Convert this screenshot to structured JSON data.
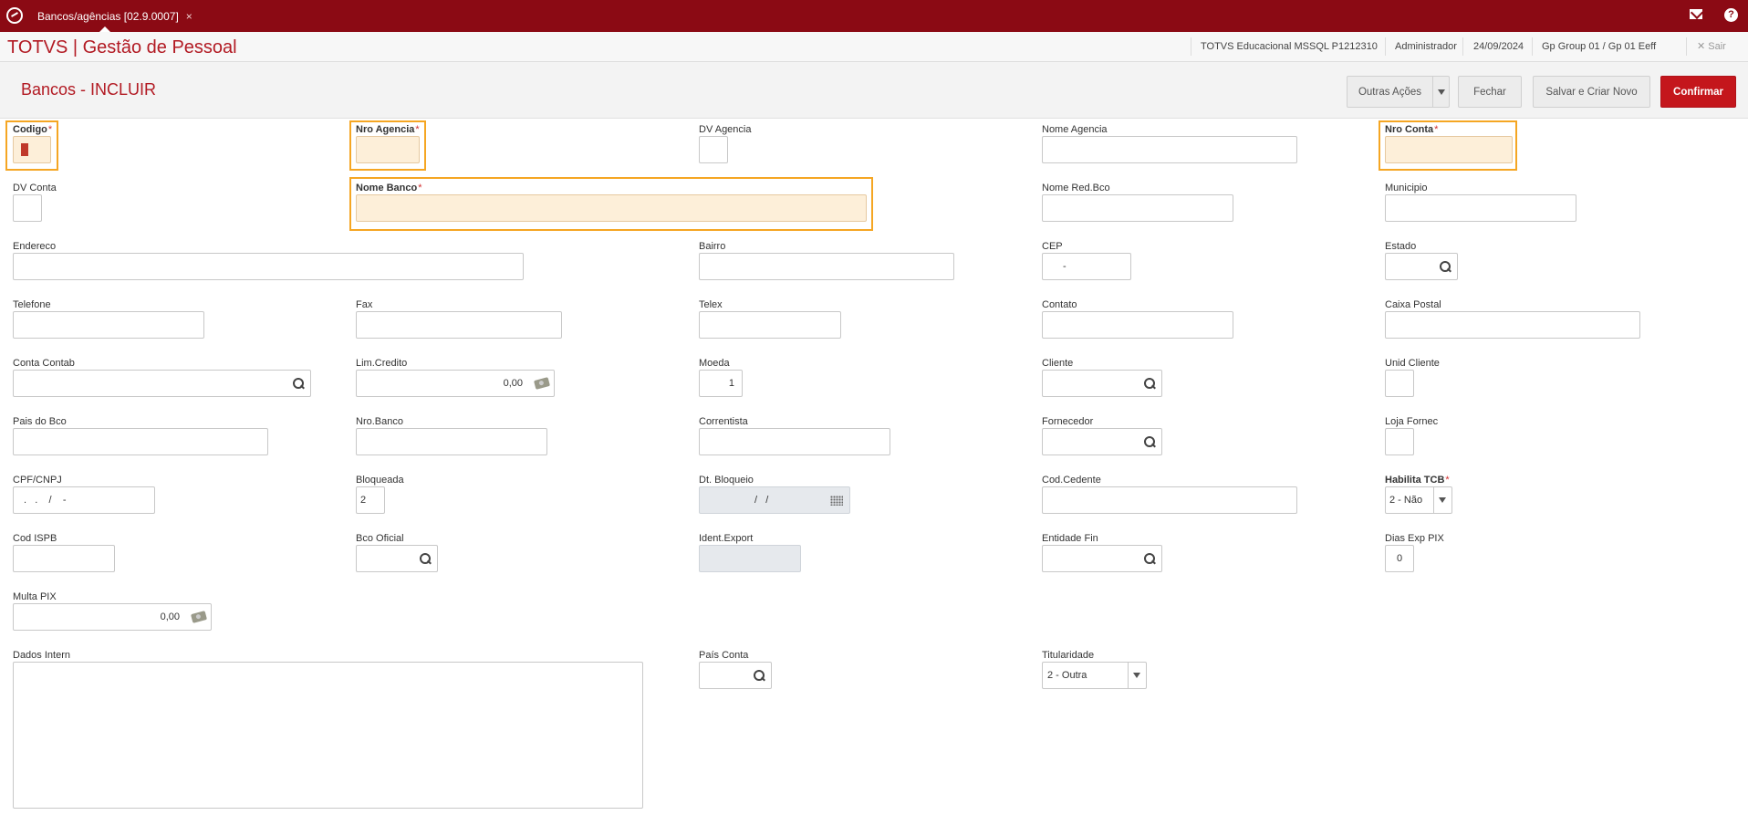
{
  "topbar": {
    "tab_label": "Bancos/agências [02.9.0007]",
    "tab_close": "×",
    "help_glyph": "?"
  },
  "appbar": {
    "title": "TOTVS | Gestão de Pessoal",
    "environment": "TOTVS Educacional MSSQL P1212310",
    "user": "Administrador",
    "date": "24/09/2024",
    "group": "Gp Group 01 / Gp 01 Eeff",
    "exit_label": "✕  Sair"
  },
  "header": {
    "page_title": "Bancos - INCLUIR",
    "buttons": {
      "outras": "Outras Ações",
      "fechar": "Fechar",
      "salvar_novo": "Salvar e Criar Novo",
      "confirmar": "Confirmar"
    }
  },
  "fields": {
    "codigo": {
      "label": "Codigo",
      "required": "*",
      "value": ""
    },
    "nro_agencia": {
      "label": "Nro Agencia",
      "required": "*",
      "value": ""
    },
    "dv_agencia": {
      "label": "DV Agencia",
      "value": ""
    },
    "nome_agencia": {
      "label": "Nome Agencia",
      "value": ""
    },
    "nro_conta": {
      "label": "Nro Conta",
      "required": "*",
      "value": ""
    },
    "dv_conta": {
      "label": "DV Conta",
      "value": ""
    },
    "nome_banco": {
      "label": "Nome Banco",
      "required": "*",
      "value": ""
    },
    "nome_red_bco": {
      "label": "Nome Red.Bco",
      "value": ""
    },
    "municipio": {
      "label": "Municipio",
      "value": ""
    },
    "endereco": {
      "label": "Endereco",
      "value": ""
    },
    "bairro": {
      "label": "Bairro",
      "value": ""
    },
    "cep": {
      "label": "CEP",
      "value": "-"
    },
    "estado": {
      "label": "Estado",
      "value": ""
    },
    "telefone": {
      "label": "Telefone",
      "value": ""
    },
    "fax": {
      "label": "Fax",
      "value": ""
    },
    "telex": {
      "label": "Telex",
      "value": ""
    },
    "contato": {
      "label": "Contato",
      "value": ""
    },
    "caixa_postal": {
      "label": "Caixa Postal",
      "value": ""
    },
    "conta_contab": {
      "label": "Conta Contab",
      "value": ""
    },
    "lim_credito": {
      "label": "Lim.Credito",
      "value": "0,00"
    },
    "moeda": {
      "label": "Moeda",
      "value": "1"
    },
    "cliente": {
      "label": "Cliente",
      "value": ""
    },
    "unid_cliente": {
      "label": "Unid Cliente",
      "value": ""
    },
    "pais_bco": {
      "label": "Pais do Bco",
      "value": ""
    },
    "nro_banco": {
      "label": "Nro.Banco",
      "value": ""
    },
    "correntista": {
      "label": "Correntista",
      "value": ""
    },
    "fornecedor": {
      "label": "Fornecedor",
      "value": ""
    },
    "loja_fornec": {
      "label": "Loja Fornec",
      "value": ""
    },
    "cpf_cnpj": {
      "label": "CPF/CNPJ",
      "value": " .   .    /    -"
    },
    "bloqueada": {
      "label": "Bloqueada",
      "value": "2"
    },
    "dt_bloqueio": {
      "label": "Dt. Bloqueio",
      "value": "/   /"
    },
    "cod_cedente": {
      "label": "Cod.Cedente",
      "value": ""
    },
    "habilita_tcb": {
      "label": "Habilita TCB",
      "required": "*",
      "value": "2 - Não"
    },
    "cod_ispb": {
      "label": "Cod ISPB",
      "value": ""
    },
    "bco_oficial": {
      "label": "Bco Oficial",
      "value": ""
    },
    "ident_export": {
      "label": "Ident.Export",
      "value": ""
    },
    "entidade_fin": {
      "label": "Entidade Fin",
      "value": ""
    },
    "dias_exp_pix": {
      "label": "Dias Exp PIX",
      "value": "0"
    },
    "multa_pix": {
      "label": "Multa PIX",
      "value": "0,00"
    },
    "dados_intern": {
      "label": "Dados Intern",
      "value": ""
    },
    "pais_conta": {
      "label": "País Conta",
      "value": ""
    },
    "titularidade": {
      "label": "Titularidade",
      "value": "2 - Outra"
    }
  },
  "colors": {
    "brand_bar": "#8b0a14",
    "brand_text": "#b21a23",
    "primary_button": "#c4161c",
    "required_highlight": "#f5a623",
    "required_fill": "#fdefd9"
  }
}
